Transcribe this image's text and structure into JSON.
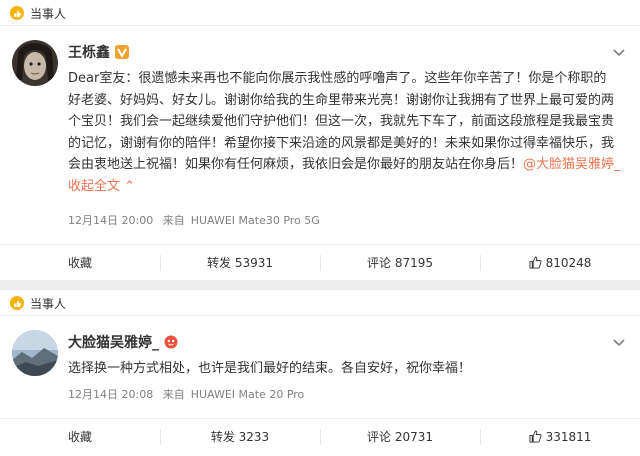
{
  "posts": [
    {
      "tag": "当事人",
      "author": "王栎鑫",
      "verified_badge_color": "#f0a22e",
      "lines": [
        "Dear室友：很遗憾未来再也不能向你展示我性感的呼噜声了。这些年你辛苦了！你是个称职的",
        "好老婆、好妈妈、好女儿。谢谢你给我的生命里带来光亮！谢谢你让我拥有了世界上最可爱的两",
        "个宝贝！我们会一起继续爱他们守护他们！但这一次，我就先下车了，前面这段旅程是我最宝贵",
        "的记忆，谢谢有你的陪伴！希望你接下来沿途的风景都是美好的！未来如果你过得幸福快乐，我",
        "会由衷地送上祝福！如果你有任何麻烦，我依旧会是你最好的朋友站在你身后！"
      ],
      "mention": "@大脸猫吴雅婷_",
      "collapse_label": "收起全文",
      "time": "12月14日 20:00",
      "source_prefix": "来自",
      "device": "HUAWEI Mate30 Pro 5G",
      "actions": {
        "fav": "收藏",
        "repost": "转发 53931",
        "comment": "评论 87195",
        "like": "810248"
      }
    },
    {
      "tag": "当事人",
      "author": "大脸猫吴雅婷_",
      "lines": [
        "选择换一种方式相处，也许是我们最好的结束。各自安好，祝你幸福！"
      ],
      "time": "12月14日 20:08",
      "source_prefix": "来自",
      "device": "HUAWEI Mate 20 Pro",
      "actions": {
        "fav": "收藏",
        "repost": "转发 3233",
        "comment": "评论 20731",
        "like": "331811"
      }
    }
  ],
  "colors": {
    "accent": "#eb7350",
    "meta": "#808080",
    "tag_icon": "#f4b400"
  }
}
